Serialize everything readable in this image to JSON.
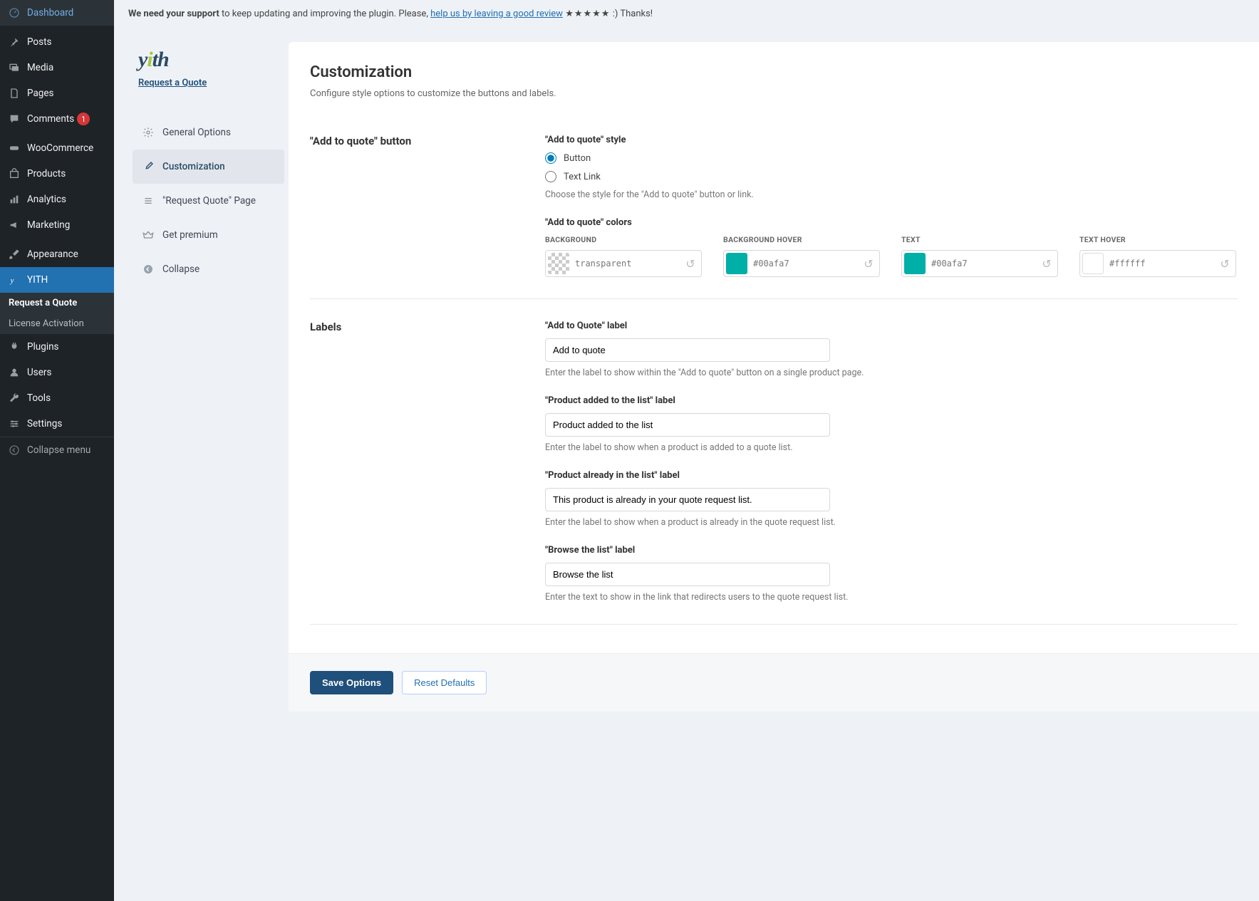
{
  "notice": {
    "lead": "We need your support",
    "text": " to keep updating and improving the plugin. Please, ",
    "link": "help us by leaving a good review",
    "trail": " :) Thanks!",
    "stars": "★★★★★"
  },
  "wp_sidebar": {
    "items": [
      {
        "label": "Dashboard"
      },
      {
        "label": "Posts"
      },
      {
        "label": "Media"
      },
      {
        "label": "Pages"
      },
      {
        "label": "Comments",
        "badge": "1"
      },
      {
        "label": "WooCommerce"
      },
      {
        "label": "Products"
      },
      {
        "label": "Analytics"
      },
      {
        "label": "Marketing"
      },
      {
        "label": "Appearance"
      },
      {
        "label": "YITH"
      },
      {
        "label": "Plugins"
      },
      {
        "label": "Users"
      },
      {
        "label": "Tools"
      },
      {
        "label": "Settings"
      }
    ],
    "yith_submenu": [
      {
        "label": "Request a Quote"
      },
      {
        "label": "License Activation"
      }
    ],
    "collapse": "Collapse menu"
  },
  "brand": {
    "name": "yith",
    "subtitle": "Request a Quote"
  },
  "yith_nav": [
    {
      "label": "General Options"
    },
    {
      "label": "Customization"
    },
    {
      "label": "\"Request Quote\" Page"
    },
    {
      "label": "Get premium"
    },
    {
      "label": "Collapse"
    }
  ],
  "page": {
    "title": "Customization",
    "desc": "Configure style options to customize the buttons and labels."
  },
  "section_button": {
    "title": "\"Add to quote\" button",
    "style_label": "\"Add to quote\" style",
    "opt_button": "Button",
    "opt_textlink": "Text Link",
    "style_help": "Choose the style for the \"Add to quote\" button or link.",
    "colors_label": "\"Add to quote\" colors",
    "colors": {
      "background": {
        "caption": "BACKGROUND",
        "value": "transparent",
        "hex": "transparent"
      },
      "background_hover": {
        "caption": "BACKGROUND HOVER",
        "value": "#00afa7",
        "hex": "#00afa7"
      },
      "text": {
        "caption": "TEXT",
        "value": "#00afa7",
        "hex": "#00afa7"
      },
      "text_hover": {
        "caption": "TEXT HOVER",
        "value": "#ffffff",
        "hex": "#ffffff"
      }
    }
  },
  "section_labels": {
    "title": "Labels",
    "fields": [
      {
        "label": "\"Add to Quote\" label",
        "value": "Add to quote",
        "help": "Enter the label to show within the \"Add to quote\" button on a single product page."
      },
      {
        "label": "\"Product added to the list\" label",
        "value": "Product added to the list",
        "help": "Enter the label to show when a product is added to a quote list."
      },
      {
        "label": "\"Product already in the list\" label",
        "value": "This product is already in your quote request list.",
        "help": "Enter the label to show when a product is already in the quote request list."
      },
      {
        "label": "\"Browse the list\" label",
        "value": "Browse the list",
        "help": "Enter the text to show in the link that redirects users to the quote request list."
      }
    ]
  },
  "footer": {
    "save": "Save Options",
    "reset": "Reset Defaults"
  }
}
